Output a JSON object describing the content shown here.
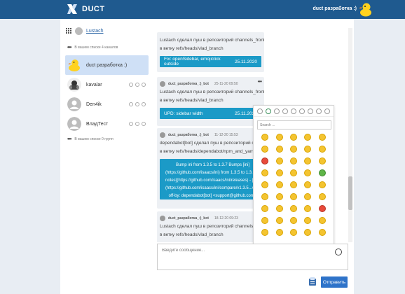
{
  "header": {
    "logo_text": "DUCT",
    "user_name": "duct разработка :)"
  },
  "sidebar": {
    "current_user": "Lustach",
    "channels_hint": "В вашем списке 4 каналов",
    "channels": [
      {
        "name": "duct разработка :)",
        "active": true,
        "avatar": "duck"
      },
      {
        "name": "kavalar",
        "active": false,
        "avatar": "kavalar"
      },
      {
        "name": "Den4ik",
        "active": false,
        "avatar": "default"
      },
      {
        "name": "ВладТест",
        "active": false,
        "avatar": "default"
      }
    ],
    "groups_hint": "В вашем списке 0 групп"
  },
  "messages": [
    {
      "author": "",
      "time": "",
      "text_lines": [
        "Lustach сделал пуш в репозиторий channels_frontend",
        "в ветку refs/heads/vlad_branch"
      ],
      "commit": {
        "title": "Fix: openSidebar, emojiclick outside",
        "date": "25.11.2020"
      }
    },
    {
      "author": "duct_разработка_:)_bot",
      "time": "25-11-20 09:50",
      "text_lines": [
        "Lustach сделал пуш в репозиторий channels_frontend",
        "в ветку refs/heads/vlad_branch"
      ],
      "commit": {
        "title": "UPD: sidebar width",
        "date": "25.11.2020"
      }
    },
    {
      "author": "duct_разработка_:)_bot",
      "time": "11-12-20 15:53",
      "text_lines": [
        "dependabot[bot] сделал пуш в репозиторий channels_frontend",
        "в ветку refs/heads/dependabot/npm_and_yarn/ini-1.3.7"
      ],
      "commit_lines": [
        "Bump ini from 1.3.5 to 1.3.7 Bumps [ini]",
        "(https://github.com/isaacs/ini) from 1.3.5 to 1.3.7. - [Release",
        "notes](https://github.com/isaacs/ini/releases) - [Commits]",
        "(https://github.com/isaacs/ini/compare/v1.3.5...v1.3.7) Signed-",
        "off-by: dependabot[bot] <support@github.com>"
      ]
    },
    {
      "author": "duct_разработка_:)_bot",
      "time": "18-12-20 09:23",
      "text_lines": [
        "Lustach сделал пуш в репозиторий channels_frontend",
        "в ветку refs/heads/vlad_branch"
      ]
    }
  ],
  "emoji_picker": {
    "search_placeholder": "Search ...",
    "tabs": [
      "recent-icon",
      "smileys-icon",
      "nature-icon",
      "food-icon",
      "activity-icon",
      "travel-icon",
      "objects-icon",
      "symbols-icon",
      "flags-icon"
    ]
  },
  "composer": {
    "placeholder": "Введите сообщение...",
    "send_label": "Отправить"
  },
  "colors": {
    "header_bg": "#1f5a8f",
    "commit_bg": "#1b9ac7",
    "send_bg": "#2e73c9",
    "active_channel_bg": "#cfe0f6"
  }
}
